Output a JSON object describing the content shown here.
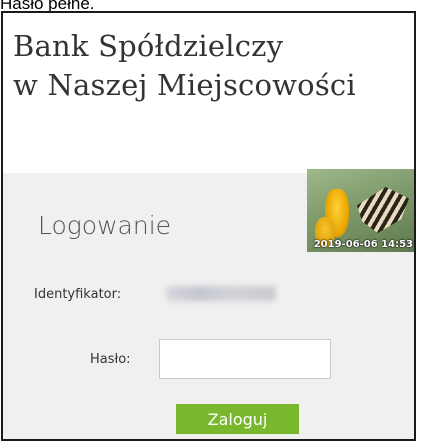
{
  "caption": "Hasło pełne.",
  "bank": {
    "name_line1": "Bank Spółdzielczy",
    "name_line2": "w Naszej Miejscowości"
  },
  "login": {
    "heading": "Logowanie",
    "identifier_label": "Identyfikator:",
    "password_label": "Hasło:",
    "password_value": "",
    "submit_label": "Zaloguj"
  },
  "photo": {
    "timestamp": "2019-06-06 14:53"
  },
  "colors": {
    "panel_background": "#f0f0f0",
    "button": "#79b72c",
    "frame_border": "#1a1a1a"
  }
}
